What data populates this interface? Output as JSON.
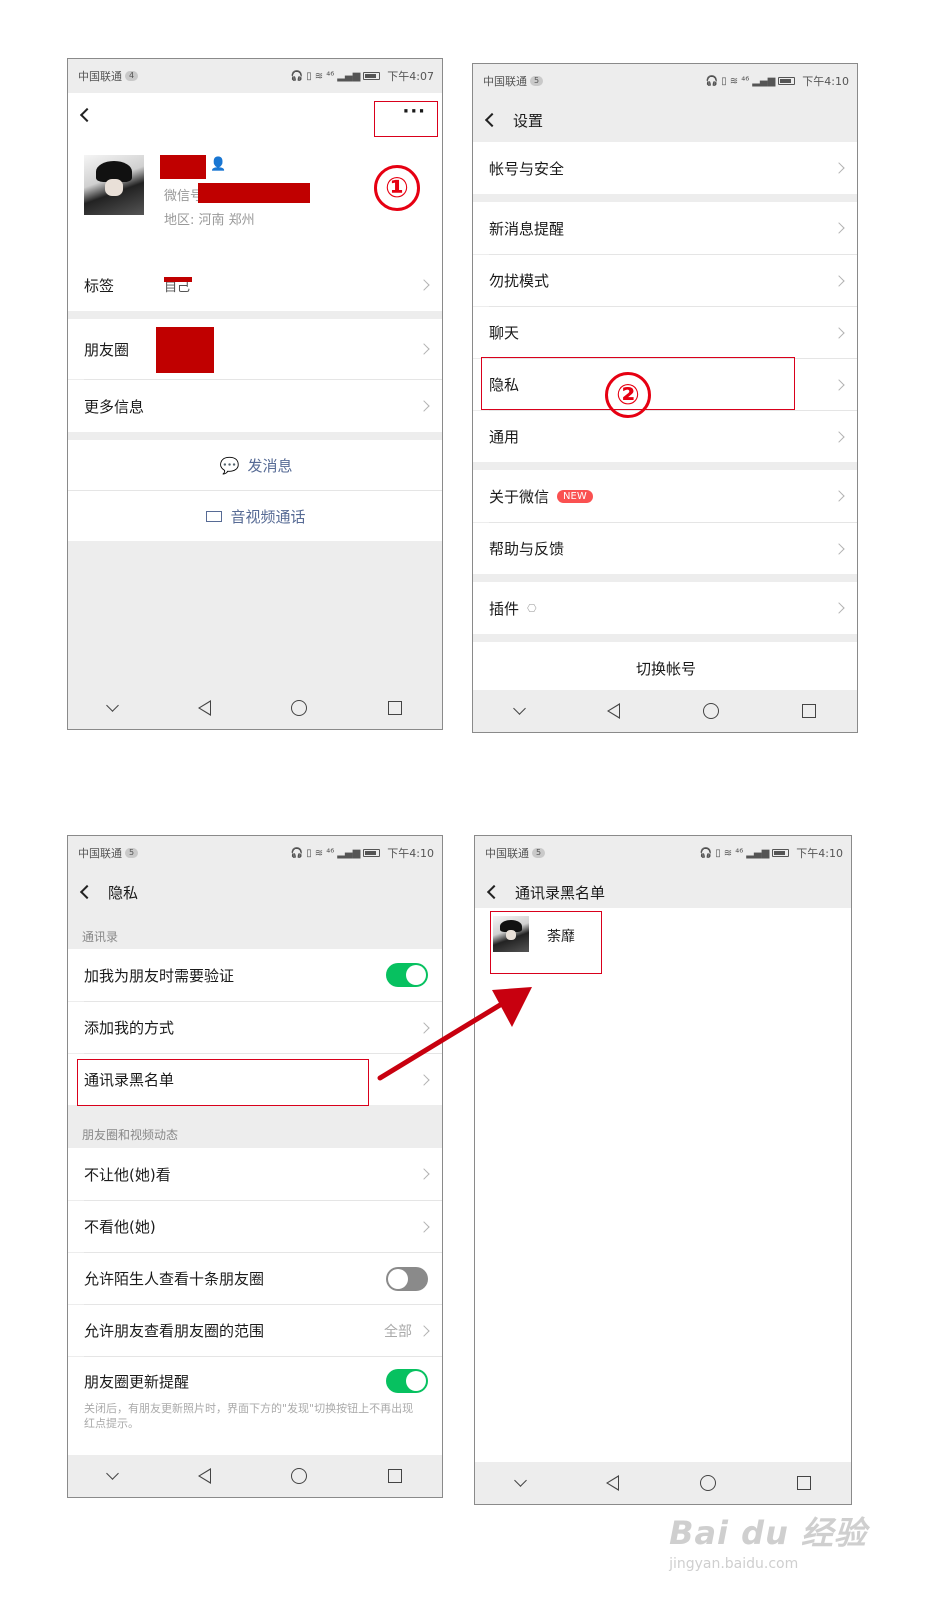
{
  "status": {
    "carrier": "中国联通",
    "sim_badges": [
      "4",
      "5",
      "5",
      "5"
    ],
    "net": "⁴⁶",
    "times": [
      "下午4:07",
      "下午4:10",
      "下午4:10",
      "下午4:10"
    ]
  },
  "profile": {
    "more_icon": "···",
    "wechat_id_label": "微信号",
    "region": "地区:  河南  郑州",
    "rows": {
      "tags": "标签",
      "tag_value": "自己",
      "moments": "朋友圈",
      "more_info": "更多信息"
    },
    "actions": {
      "send_message": "发消息",
      "av_call": "音视频通话"
    }
  },
  "settings": {
    "title": "设置",
    "items": {
      "account_security": "帐号与安全",
      "new_message": "新消息提醒",
      "dnd": "勿扰模式",
      "chat": "聊天",
      "privacy": "隐私",
      "general": "通用",
      "about": "关于微信",
      "new_badge": "NEW",
      "help": "帮助与反馈",
      "plugins": "插件",
      "switch_account": "切换帐号"
    }
  },
  "privacy": {
    "title": "隐私",
    "section_contacts": "通讯录",
    "verify_friend": "加我为朋友时需要验证",
    "add_me_methods": "添加我的方式",
    "blacklist": "通讯录黑名单",
    "section_moments": "朋友圈和视频动态",
    "hide_my_posts": "不让他(她)看",
    "hide_their_posts": "不看他(她)",
    "stranger_ten_posts": "允许陌生人查看十条朋友圈",
    "moments_range": "允许朋友查看朋友圈的范围",
    "moments_range_value": "全部",
    "moments_update_reminder": "朋友圈更新提醒",
    "reminder_desc": "关闭后，有朋友更新照片时，界面下方的\"发现\"切换按钮上不再出现红点提示。",
    "toggles": {
      "verify_friend": true,
      "stranger_ten_posts": false,
      "moments_update_reminder": true
    }
  },
  "blacklist": {
    "title": "通讯录黑名单",
    "contact_name": "荼靡"
  },
  "annotations": {
    "step1": "①",
    "step2": "②"
  },
  "watermark": {
    "brand": "Bai du 经验",
    "url": "jingyan.baidu.com"
  },
  "colors": {
    "annotation_red": "#d9001b",
    "wechat_green": "#07c160",
    "link_blue": "#576b95",
    "new_badge": "#fa5151"
  }
}
